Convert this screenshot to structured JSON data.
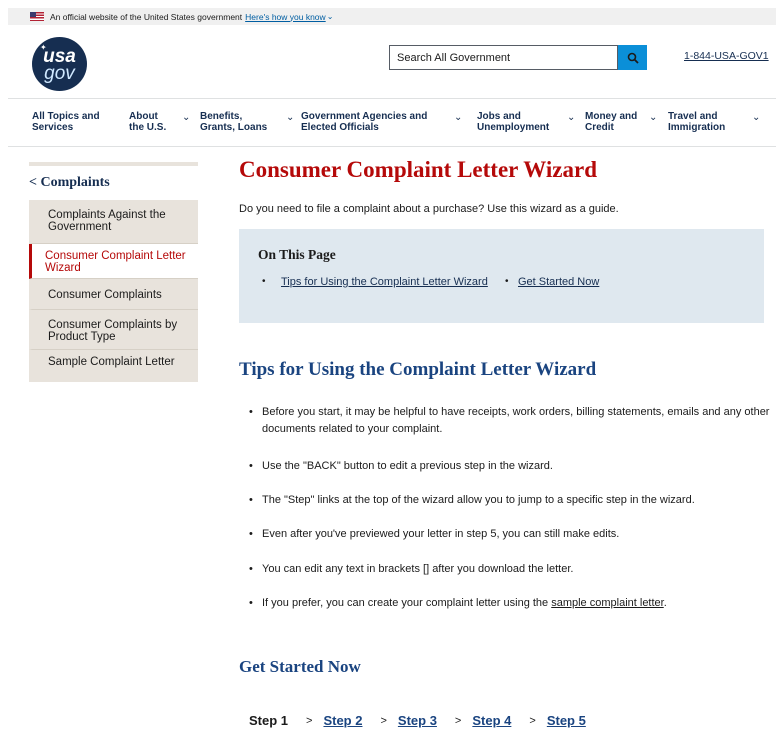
{
  "banner": {
    "text": "An official website of the United States government",
    "link": "Here's how you know"
  },
  "logo": {
    "line1": "usa",
    "line2": "gov"
  },
  "search": {
    "value": "Search All Government"
  },
  "phone": "1-844-USA-GOV1",
  "nav": [
    {
      "label_1": "All Topics and",
      "label_2": "Services"
    },
    {
      "label_1": "About",
      "label_2": "the U.S."
    },
    {
      "label_1": "Benefits,",
      "label_2": "Grants, Loans"
    },
    {
      "label_1": "Government Agencies and",
      "label_2": "Elected Officials"
    },
    {
      "label_1": "Jobs and",
      "label_2": "Unemployment"
    },
    {
      "label_1": "Money and",
      "label_2": "Credit"
    },
    {
      "label_1": "Travel and",
      "label_2": "Immigration"
    }
  ],
  "sidebar": {
    "heading": "< Complaints",
    "items": [
      "Complaints Against the Government",
      "Consumer Complaint Letter Wizard",
      "Consumer Complaints",
      "Consumer Complaints by Product Type",
      "Sample Complaint Letter"
    ]
  },
  "main": {
    "title": "Consumer Complaint Letter Wizard",
    "intro": "Do you need to file a complaint about a purchase? Use this wizard as a guide.",
    "on_this_page": {
      "title": "On This Page",
      "links": [
        "Tips for Using the Complaint Letter Wizard",
        "Get Started Now"
      ]
    },
    "tips_heading": "Tips for Using the Complaint Letter Wizard",
    "tips": [
      "Before you start, it may be helpful to have receipts, work orders, billing statements, emails and any other documents related to your complaint.",
      "Use the \"BACK\" button to edit a previous step in the wizard.",
      "The \"Step\" links at the top of the wizard allow you to jump to a specific step in the wizard.",
      "Even after you've previewed your letter in step 5, you can still make edits.",
      "You can edit any text in brackets [] after you download the letter."
    ],
    "tip_last": {
      "before": "If you prefer, you can create your complaint letter using the ",
      "link": "sample complaint letter",
      "after": "."
    },
    "get_started_heading": "Get Started Now",
    "steps": {
      "current": "Step 1",
      "separator": ">",
      "links": [
        "Step 2",
        "Step 3",
        "Step 4",
        "Step 5"
      ]
    }
  },
  "colors": {
    "accent_red": "#b50909",
    "navy": "#162e51",
    "heading_blue": "#1a4480",
    "search_blue": "#0b8fd8",
    "sidebar_bg": "#e8e3dc",
    "otp_bg": "#dfe8ef"
  }
}
